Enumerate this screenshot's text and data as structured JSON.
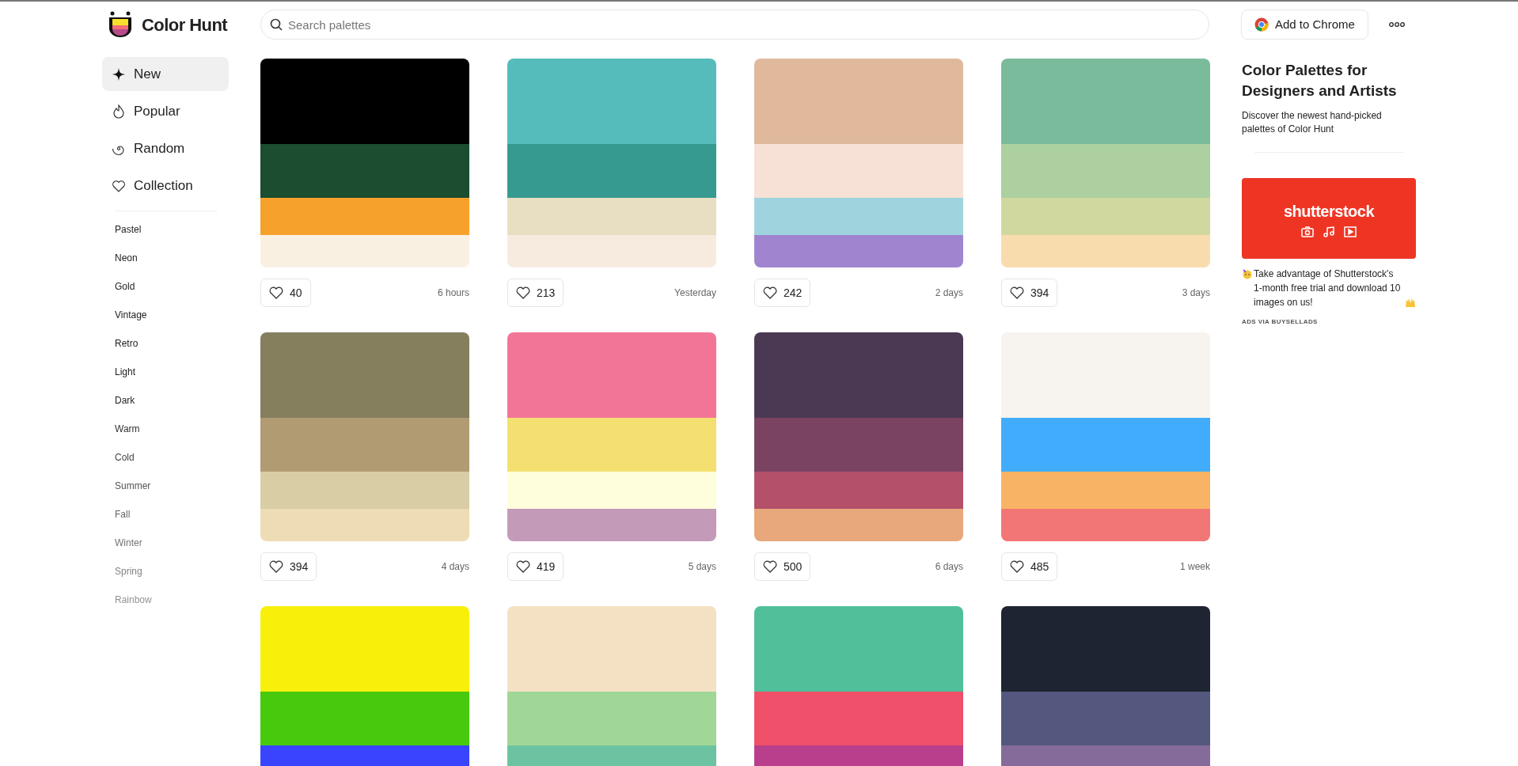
{
  "header": {
    "logo_text": "Color Hunt",
    "search": {
      "placeholder": "Search palettes"
    },
    "extension_button": "Add to Chrome"
  },
  "sidebar": {
    "nav": [
      {
        "label": "New",
        "kind": "new",
        "selected": true
      },
      {
        "label": "Popular",
        "kind": "popular",
        "selected": false
      },
      {
        "label": "Random",
        "kind": "random",
        "selected": false
      },
      {
        "label": "Collection",
        "kind": "collection",
        "selected": false
      }
    ],
    "tags": [
      "Pastel",
      "Neon",
      "Gold",
      "Vintage",
      "Retro",
      "Light",
      "Dark",
      "Warm",
      "Cold",
      "Summer",
      "Fall",
      "Winter",
      "Spring",
      "Rainbow"
    ]
  },
  "palettes": [
    {
      "stripes": [
        {
          "color": "#000000"
        },
        {
          "color": "#1b4d30"
        },
        {
          "color": "#f6a12c"
        },
        {
          "color": "#faf0e2"
        }
      ],
      "likes": "40",
      "time": "6 hours"
    },
    {
      "stripes": [
        {
          "color": "#56bcbb"
        },
        {
          "color": "#379a90"
        },
        {
          "color": "#e8dec2"
        },
        {
          "color": "#f7ebe0"
        }
      ],
      "likes": "213",
      "time": "Yesterday"
    },
    {
      "stripes": [
        {
          "color": "#e0b99c"
        },
        {
          "color": "#f7e1d6"
        },
        {
          "color": "#9fd4df"
        },
        {
          "color": "#a084d0"
        }
      ],
      "likes": "242",
      "time": "2 days"
    },
    {
      "stripes": [
        {
          "color": "#79bb9b"
        },
        {
          "color": "#acd0a0"
        },
        {
          "color": "#d0d8a0"
        },
        {
          "color": "#f9dcae"
        }
      ],
      "likes": "394",
      "time": "3 days"
    },
    {
      "stripes": [
        {
          "color": "#857f5e"
        },
        {
          "color": "#b09b72"
        },
        {
          "color": "#d9cda5"
        },
        {
          "color": "#eedcb5"
        }
      ],
      "likes": "394",
      "time": "4 days"
    },
    {
      "stripes": [
        {
          "color": "#f27598"
        },
        {
          "color": "#f4e070"
        },
        {
          "color": "#fefddc"
        },
        {
          "color": "#c49ab9"
        }
      ],
      "likes": "419",
      "time": "5 days"
    },
    {
      "stripes": [
        {
          "color": "#4b3853"
        },
        {
          "color": "#7a4361"
        },
        {
          "color": "#b45069"
        },
        {
          "color": "#e8a87b"
        }
      ],
      "likes": "500",
      "time": "6 days"
    },
    {
      "stripes": [
        {
          "color": "#f7f3ef"
        },
        {
          "color": "#41acfc"
        },
        {
          "color": "#f8b464"
        },
        {
          "color": "#f37676"
        }
      ],
      "likes": "485",
      "time": "1 week"
    },
    {
      "stripes": [
        {
          "color": "#f8ef0b"
        },
        {
          "color": "#47c90e"
        },
        {
          "color": "#3a44ff"
        }
      ]
    },
    {
      "stripes": [
        {
          "color": "#f4e1c4"
        },
        {
          "color": "#a1d796"
        },
        {
          "color": "#6cc3a1"
        }
      ]
    },
    {
      "stripes": [
        {
          "color": "#51c09a"
        },
        {
          "color": "#f0506a"
        },
        {
          "color": "#b93e8c"
        }
      ]
    },
    {
      "stripes": [
        {
          "color": "#1e2432"
        },
        {
          "color": "#54587e"
        },
        {
          "color": "#856b9a"
        }
      ]
    }
  ],
  "aside": {
    "title": "Color Palettes for Designers and Artists",
    "subtitle": "Discover the newest hand-picked palettes of Color Hunt",
    "ad": {
      "brand": "shutterstock",
      "text": "Take advantage of Shutterstock's 1-month free trial and download 10 images on us!",
      "footer": "ADS VIA BUYSELLADS"
    }
  }
}
